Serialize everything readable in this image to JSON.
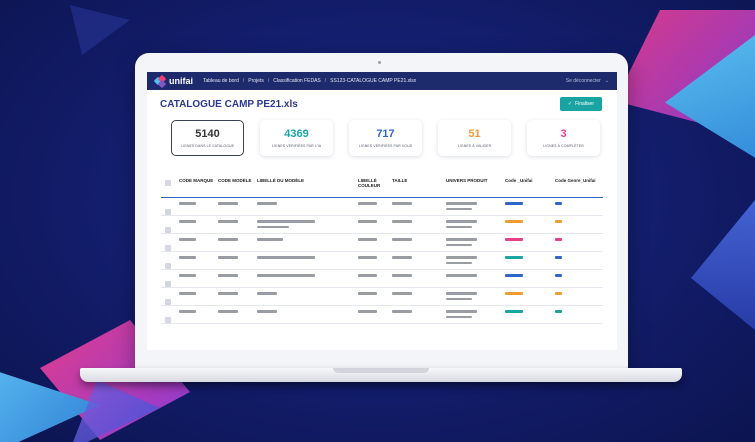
{
  "app": {
    "brand": "unifai"
  },
  "nav": {
    "breadcrumbs": [
      "Tableau de bord",
      "Projets",
      "Classification FEDAS",
      "SS123-CATALOGUE CAMP PE21.xlsx"
    ],
    "logout_label": "Se déconnecter"
  },
  "header": {
    "title": "CATALOGUE CAMP PE21.xls",
    "finalize_label": "Finaliser"
  },
  "stats": [
    {
      "value": "5140",
      "label": "LIGNES DANS LE CATALOGUE",
      "color": "#333333",
      "active": true
    },
    {
      "value": "4369",
      "label": "LIGNES VÉRIFIÉES PAR L'IA",
      "color": "#19a5a5",
      "active": false
    },
    {
      "value": "717",
      "label": "LIGNES VÉRIFIÉES PAR VOUS",
      "color": "#2f66c9",
      "active": false
    },
    {
      "value": "51",
      "label": "LIGNES À VALIDER",
      "color": "#f39c33",
      "active": false
    },
    {
      "value": "3",
      "label": "LIGNES À COMPLÉTER",
      "color": "#e83e8c",
      "active": false
    }
  ],
  "table": {
    "headers": {
      "code_marque": "CODE MARQUE",
      "code_modele": "CODE MODÈLE",
      "libelle_modele": "LIBELLÉ DU MODÈLE",
      "libelle_couleur": "LIBELLÉ COULEUR",
      "taille": "TAILLE",
      "univers_produit": "UNIVERS PRODUIT",
      "code_unifai": "Code _Unifai",
      "code_genre_unifai": "Code Genre_Unifai"
    },
    "rows": [
      {
        "lib_lines": 1,
        "univ_lines": 2,
        "code_color": "#2f66c9",
        "genre_color": "#2f66c9"
      },
      {
        "lib_lines": 2,
        "univ_lines": 2,
        "code_color": "#f39c33",
        "genre_color": "#f39c33"
      },
      {
        "lib_lines": 1,
        "univ_lines": 2,
        "code_color": "#e83e8c",
        "genre_color": "#e83e8c"
      },
      {
        "lib_lines": 1,
        "univ_lines": 2,
        "code_color": "#19a5a5",
        "genre_color": "#2f66c9"
      },
      {
        "lib_lines": 1,
        "univ_lines": 1,
        "code_color": "#2f66c9",
        "genre_color": "#2f66c9"
      },
      {
        "lib_lines": 1,
        "univ_lines": 2,
        "code_color": "#f39c33",
        "genre_color": "#f39c33"
      },
      {
        "lib_lines": 1,
        "univ_lines": 2,
        "code_color": "#19a5a5",
        "genre_color": "#19a5a5"
      }
    ]
  }
}
